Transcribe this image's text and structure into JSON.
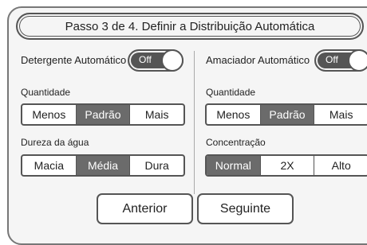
{
  "title": "Passo 3 de 4. Definir a Distribuição Automática",
  "left": {
    "toggle_label": "Detergente Automático",
    "toggle_state": "Off",
    "quantity_label": "Quantidade",
    "quantity_options": [
      "Menos",
      "Padrão",
      "Mais"
    ],
    "quantity_selected": "Padrão",
    "hardness_label": "Dureza da água",
    "hardness_options": [
      "Macia",
      "Média",
      "Dura"
    ],
    "hardness_selected": "Média"
  },
  "right": {
    "toggle_label": "Amaciador Automático",
    "toggle_state": "Off",
    "quantity_label": "Quantidade",
    "quantity_options": [
      "Menos",
      "Padrão",
      "Mais"
    ],
    "quantity_selected": "Padrão",
    "concentration_label": "Concentração",
    "concentration_options": [
      "Normal",
      "2X",
      "Alto"
    ],
    "concentration_selected": "Normal"
  },
  "nav": {
    "back_label": "Anterior",
    "next_label": "Seguinte"
  },
  "colors": {
    "selected": "#6b6b6b",
    "border": "#555555",
    "panel_bg": "#f5f5f5"
  }
}
